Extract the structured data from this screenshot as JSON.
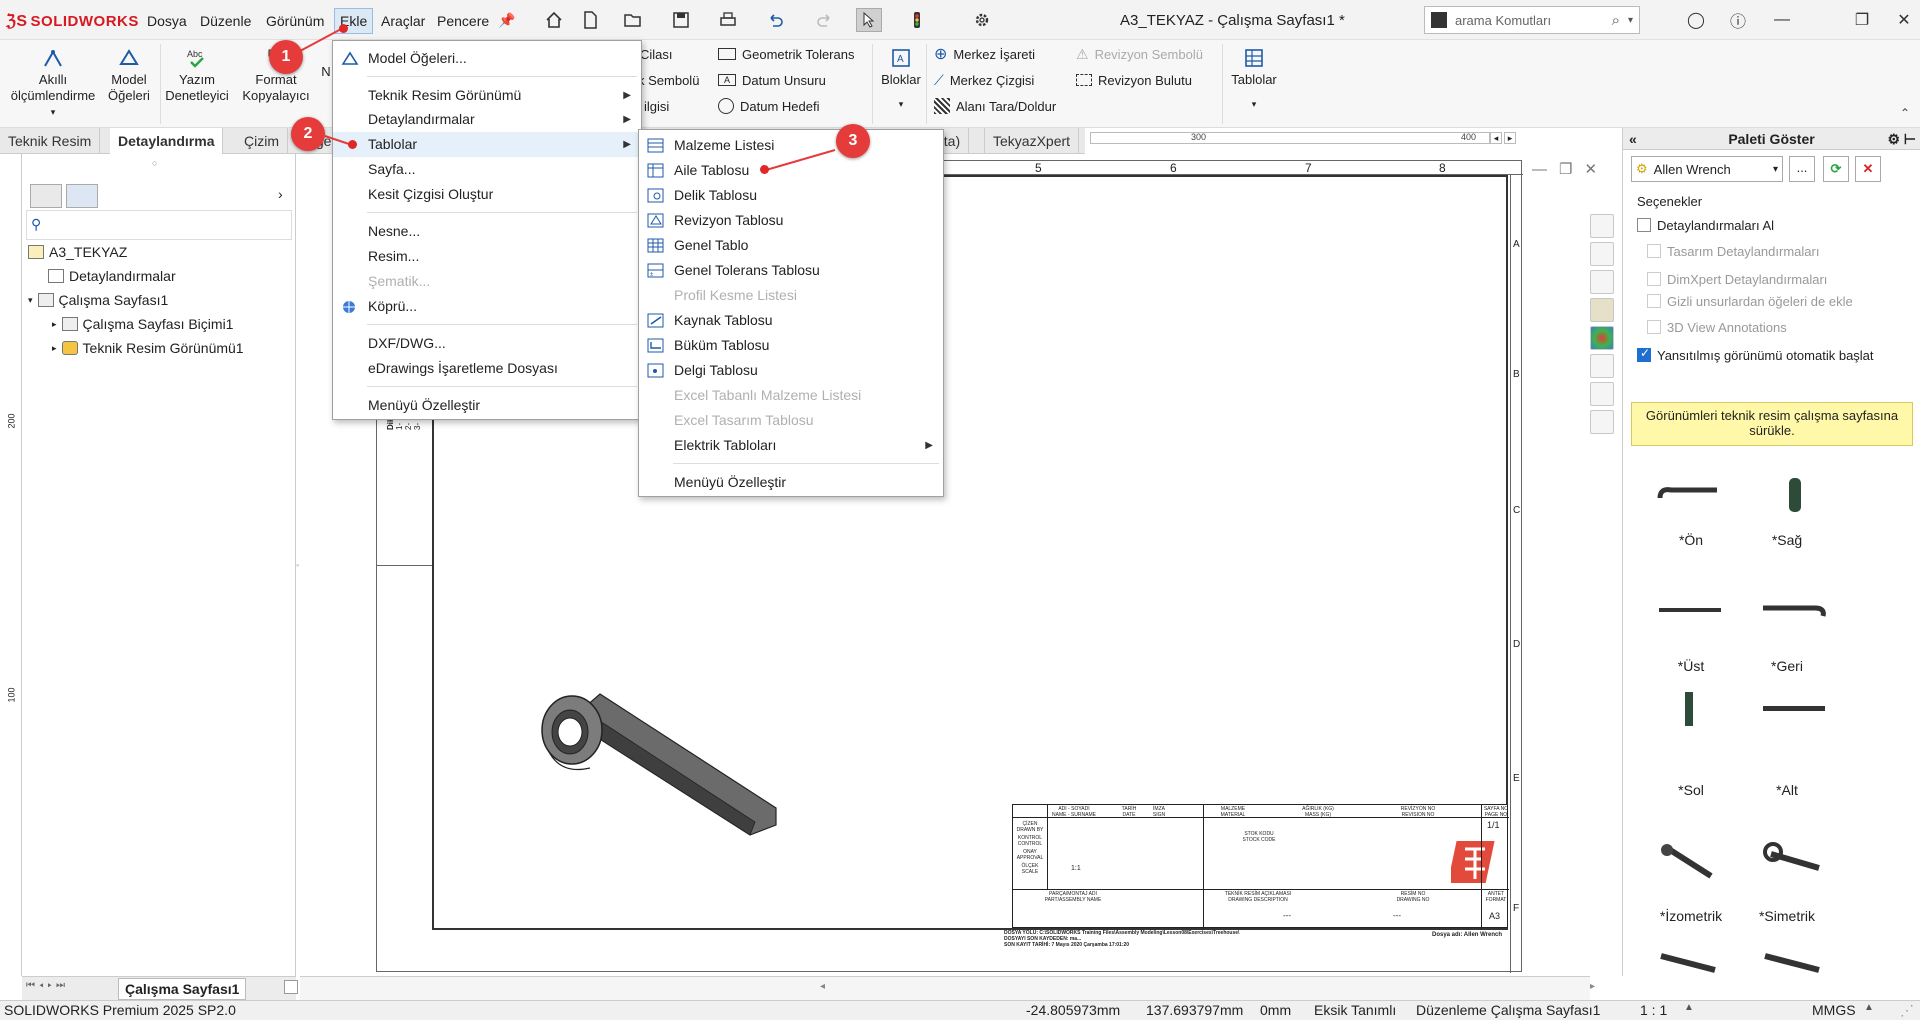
{
  "app": {
    "brand": "SOLIDWORKS",
    "title": "A3_TEKYAZ - Çalışma Sayfası1 *"
  },
  "menubar": {
    "items": [
      "Dosya",
      "Düzenle",
      "Görünüm",
      "Ekle",
      "Araçlar",
      "Pencere"
    ]
  },
  "search": {
    "placeholder": "arama Komutları"
  },
  "ribbon": {
    "akilli": "Akıllı ölçümlendirme",
    "model_ogeleri": "Model Öğeleri",
    "yazim": "Yazım Denetleyici",
    "format": "Format Kopyalayıcı",
    "n_label": "N",
    "cilasi": "Cilası",
    "sembolu": "k Sembolü",
    "bilgisi": "ilgisi",
    "geo_tol": "Geometrik Tolerans",
    "datum_unsuru": "Datum Unsuru",
    "datum_hedefi": "Datum Hedefi",
    "bloklar": "Bloklar",
    "merkez_isareti": "Merkez İşareti",
    "merkez_cizgisi": "Merkez Çizgisi",
    "alani_tara": "Alanı Tara/Doldur",
    "rev_sembolu": "Revizyon Sembolü",
    "rev_bulutu": "Revizyon Bulutu",
    "tablolar": "Tablolar"
  },
  "tabs": [
    "Teknik Resim",
    "Detaylandırma",
    "Çizim",
    "Değe",
    "eta)",
    "TekyazXpert"
  ],
  "ruler": {
    "n300": "300",
    "n400": "400"
  },
  "sheet_cols": [
    "5",
    "6",
    "7",
    "8"
  ],
  "sheet_rows": [
    "A",
    "B",
    "C",
    "D",
    "E",
    "F"
  ],
  "left_ruler": {
    "n200": "200",
    "n100": "100"
  },
  "tree": {
    "root": "A3_TEKYAZ",
    "items": [
      "Detaylandırmalar",
      "Çalışma Sayfası1",
      "Çalışma Sayfası Biçimi1",
      "Teknik Resim Görünümü1"
    ]
  },
  "sheet_tab": "Çalışma Sayfası1",
  "ekle_menu": {
    "items": [
      "Model Öğeleri...",
      "Teknik Resim Görünümü",
      "Detaylandırmalar",
      "Tablolar",
      "Sayfa...",
      "Kesit Çizgisi Oluştur",
      "Nesne...",
      "Resim...",
      "Şematik...",
      "Köprü...",
      "DXF/DWG...",
      "eDrawings İşaretleme Dosyası",
      "Menüyü Özelleştir"
    ]
  },
  "tablolar_menu": {
    "items": [
      "Malzeme Listesi",
      "Aile Tablosu",
      "Delik Tablosu",
      "Revizyon Tablosu",
      "Genel Tablo",
      "Genel Tolerans Tablosu",
      "Profil Kesme Listesi",
      "Kaynak Tablosu",
      "Büküm Tablosu",
      "Delgi Tablosu",
      "Excel Tabanlı Malzeme Listesi",
      "Excel Tasarım Tablosu",
      "Elektrik Tabloları",
      "Menüyü Özelleştir"
    ]
  },
  "callouts": [
    "1",
    "2",
    "3"
  ],
  "palette": {
    "title": "Paleti Göster",
    "model": "Allen Wrench",
    "options_title": "Seçenekler",
    "detay_al": "Detaylandırmaları Al",
    "tasarim": "Tasarım Detaylandırmaları",
    "dimxpert": "DimXpert Detaylandırmaları",
    "gizli": "Gizli unsurlardan öğeleri de ekle",
    "view3d": "3D View Annotations",
    "yansit": "Yansıtılmış görünümü otomatik başlat",
    "hint": "Görünümleri teknik resim çalışma sayfasına sürükle.",
    "views": [
      "*Ön",
      "*Sağ",
      "*Üst",
      "*Geri",
      "*Sol",
      "*Alt",
      "*İzometrik",
      "*Simetrik"
    ]
  },
  "dikkat": {
    "title": "Dikkat",
    "l1": "1- Resim",
    "l2": "2- Form",
    "l3": "3- Resim"
  },
  "titleblock": {
    "adi_soyadi": "ADI - SOYADI",
    "name": "NAME - SURNAME",
    "tarih": "TARİH",
    "date": "DATE",
    "imza": "İMZA",
    "sign": "SIGN",
    "malzeme": "MALZEME",
    "material": "MATERIAL",
    "agirlik": "AĞIRLIK (KG)",
    "mass": "MASS (KG)",
    "revizyon": "REVİZYON NO",
    "revision": "REVISION NO",
    "sayfa": "SAYFA NO",
    "page": "PAGE NO",
    "cizen": "ÇİZEN",
    "drawn": "DRAWN BY",
    "kontrol": "KONTROL",
    "control": "CONTROL",
    "onay": "ONAY",
    "approval": "APPROVAL",
    "olcek": "ÖLÇEK",
    "scale": "SCALE",
    "scale_val": "1:1",
    "stok": "STOK KODU",
    "stock": "STOCK CODE",
    "page_val": "1/1",
    "parca": "PARÇA/MONTAJ ADI",
    "part": "PART/ASSEMBLY NAME",
    "aciklama": "TEKNİK RESİM AÇIKLAMASI",
    "desc": "DRAWING DESCRIPTION",
    "resim_no": "RESİM NO",
    "drawing_no": "DRAWING NO",
    "antet": "ANTET",
    "format": "FORMAT",
    "format_val": "A3",
    "dash": "---",
    "dosya_yolu": "DOSYA YOLU: C:\\SOLIDWORKS Training Files\\Assembly Modeling\\Lesson08\\Exercises\\Treehouse\\",
    "kaydeden": "DOSYAYI SON KAYDEDEN: ma...",
    "kayit": "SON KAYIT TARİHİ: 7 Mayıs 2020 Çarşamba 17:01:20",
    "dosya_adi": "Dosya adı: Allen Wrench"
  },
  "status": {
    "product": "SOLIDWORKS Premium 2025 SP2.0",
    "x": "-24.805973mm",
    "y": "137.693797mm",
    "z": "0mm",
    "def": "Eksik Tanımlı",
    "mode": "Düzenleme Çalışma Sayfası1",
    "scale": "1 : 1",
    "units": "MMGS"
  }
}
